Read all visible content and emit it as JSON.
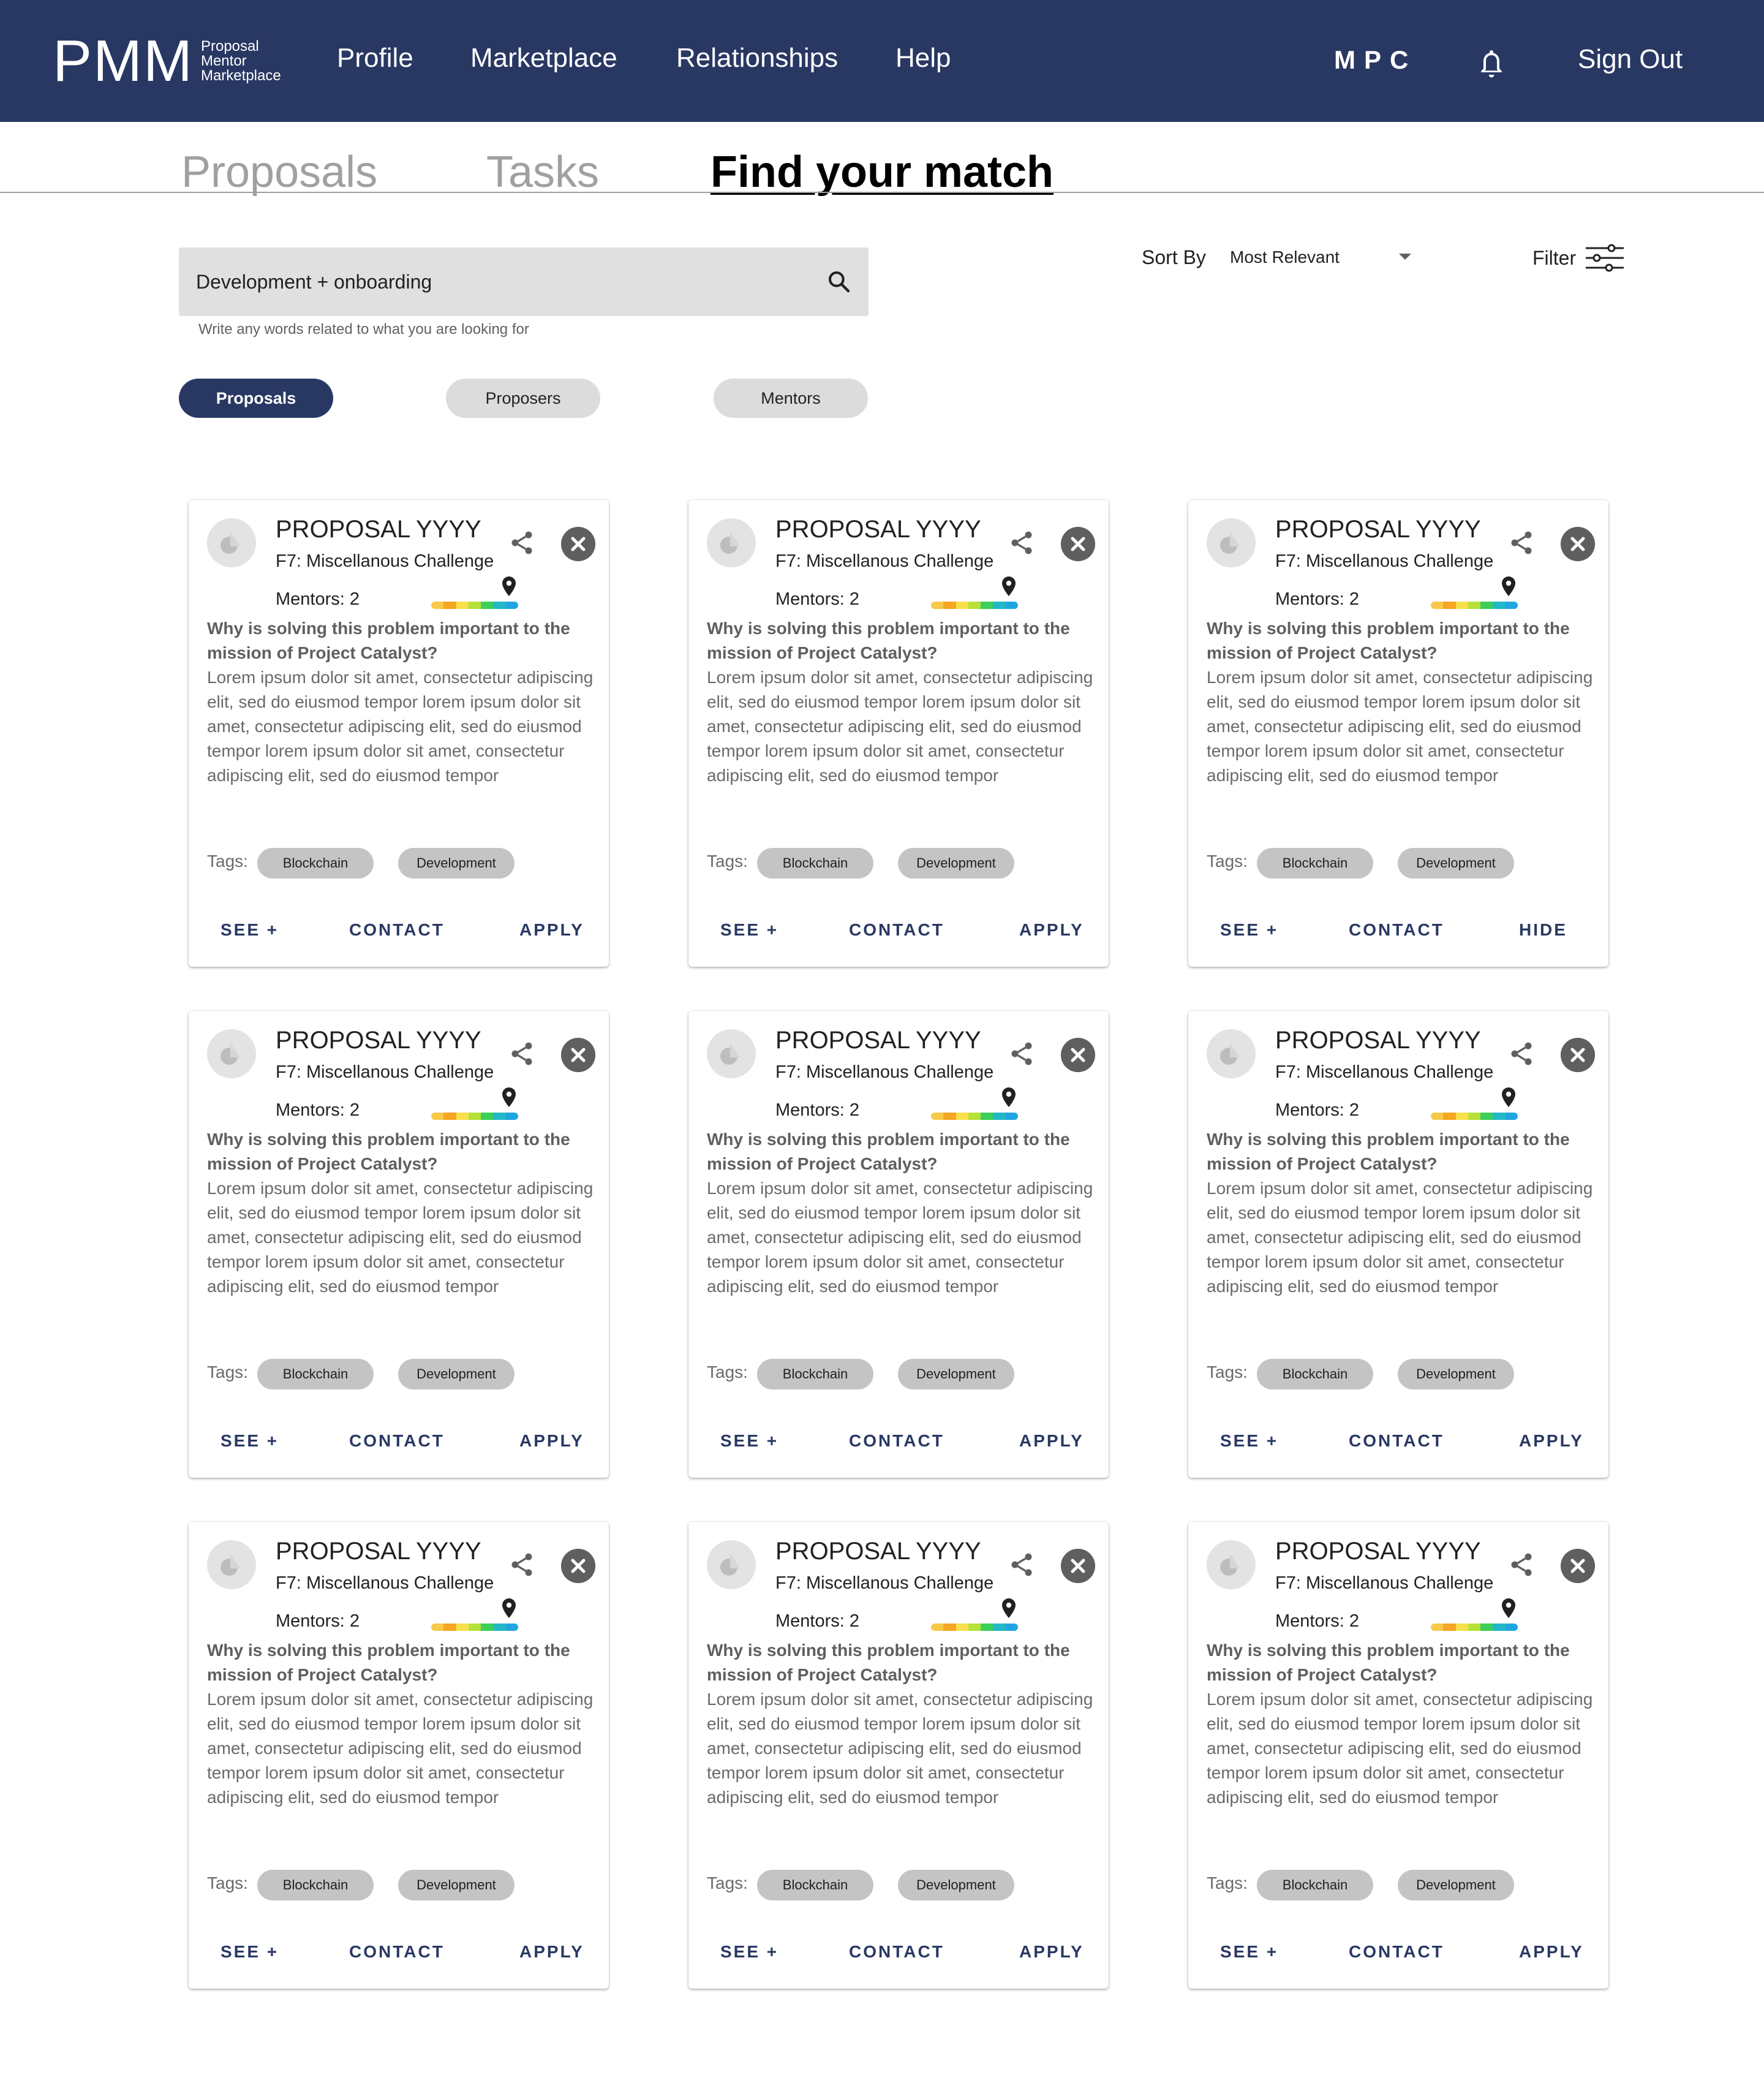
{
  "header": {
    "logo": {
      "mark": "PMM",
      "line1": "Proposal",
      "line2": "Mentor",
      "line3": "Marketplace"
    },
    "nav": [
      "Profile",
      "Marketplace",
      "Relationships",
      "Help"
    ],
    "user_initials": "MPC",
    "sign_out": "Sign Out",
    "colors": {
      "navbar": "#293863",
      "text": "#ffffff"
    }
  },
  "tabs": [
    "Proposals",
    "Tasks",
    "Find your match"
  ],
  "active_tab": "Find your match",
  "search": {
    "value": "Development + onboarding",
    "helper": "Write any words related to what you are looking for"
  },
  "sort": {
    "label": "Sort By",
    "value": "Most Relevant"
  },
  "filter": {
    "label": "Filter"
  },
  "chips": [
    "Proposals",
    "Proposers",
    "Mentors"
  ],
  "active_chip": "Proposals",
  "cards": [
    {
      "title": "PROPOSAL YYYY",
      "challenge": "F7: Miscellanous Challenge",
      "mentors": "Mentors: 2",
      "question": "Why is solving this problem important to the mission of Project Catalyst?",
      "body": "Lorem ipsum dolor sit amet, consectetur adipiscing elit, sed do eiusmod tempor lorem ipsum dolor sit amet, consectetur adipiscing elit, sed do eiusmod tempor lorem ipsum dolor sit amet, consectetur adipiscing elit, sed do eiusmod tempor",
      "tags_label": "Tags:",
      "tags": [
        "Blockchain",
        "Development"
      ],
      "actions": [
        "SEE +",
        "CONTACT",
        "APPLY"
      ]
    },
    {
      "title": "PROPOSAL YYYY",
      "challenge": "F7: Miscellanous Challenge",
      "mentors": "Mentors: 2",
      "question": "Why is solving this problem important to the mission of Project Catalyst?",
      "body": "Lorem ipsum dolor sit amet, consectetur adipiscing elit, sed do eiusmod tempor lorem ipsum dolor sit amet, consectetur adipiscing elit, sed do eiusmod tempor lorem ipsum dolor sit amet, consectetur adipiscing elit, sed do eiusmod tempor",
      "tags_label": "Tags:",
      "tags": [
        "Blockchain",
        "Development"
      ],
      "actions": [
        "SEE +",
        "CONTACT",
        "APPLY"
      ]
    },
    {
      "title": "PROPOSAL YYYY",
      "challenge": "F7: Miscellanous Challenge",
      "mentors": "Mentors: 2",
      "question": "Why is solving this problem important to the mission of Project Catalyst?",
      "body": "Lorem ipsum dolor sit amet, consectetur adipiscing elit, sed do eiusmod tempor lorem ipsum dolor sit amet, consectetur adipiscing elit, sed do eiusmod tempor lorem ipsum dolor sit amet, consectetur adipiscing elit, sed do eiusmod tempor",
      "tags_label": "Tags:",
      "tags": [
        "Blockchain",
        "Development"
      ],
      "actions": [
        "SEE +",
        "CONTACT",
        "HIDE"
      ]
    },
    {
      "title": "PROPOSAL YYYY",
      "challenge": "F7: Miscellanous Challenge",
      "mentors": "Mentors: 2",
      "question": "Why is solving this problem important to the mission of Project Catalyst?",
      "body": "Lorem ipsum dolor sit amet, consectetur adipiscing elit, sed do eiusmod tempor lorem ipsum dolor sit amet, consectetur adipiscing elit, sed do eiusmod tempor lorem ipsum dolor sit amet, consectetur adipiscing elit, sed do eiusmod tempor",
      "tags_label": "Tags:",
      "tags": [
        "Blockchain",
        "Development"
      ],
      "actions": [
        "SEE +",
        "CONTACT",
        "APPLY"
      ]
    },
    {
      "title": "PROPOSAL YYYY",
      "challenge": "F7: Miscellanous Challenge",
      "mentors": "Mentors: 2",
      "question": "Why is solving this problem important to the mission of Project Catalyst?",
      "body": "Lorem ipsum dolor sit amet, consectetur adipiscing elit, sed do eiusmod tempor lorem ipsum dolor sit amet, consectetur adipiscing elit, sed do eiusmod tempor lorem ipsum dolor sit amet, consectetur adipiscing elit, sed do eiusmod tempor",
      "tags_label": "Tags:",
      "tags": [
        "Blockchain",
        "Development"
      ],
      "actions": [
        "SEE +",
        "CONTACT",
        "APPLY"
      ]
    },
    {
      "title": "PROPOSAL YYYY",
      "challenge": "F7: Miscellanous Challenge",
      "mentors": "Mentors: 2",
      "question": "Why is solving this problem important to the mission of Project Catalyst?",
      "body": "Lorem ipsum dolor sit amet, consectetur adipiscing elit, sed do eiusmod tempor lorem ipsum dolor sit amet, consectetur adipiscing elit, sed do eiusmod tempor lorem ipsum dolor sit amet, consectetur adipiscing elit, sed do eiusmod tempor",
      "tags_label": "Tags:",
      "tags": [
        "Blockchain",
        "Development"
      ],
      "actions": [
        "SEE +",
        "CONTACT",
        "APPLY"
      ]
    },
    {
      "title": "PROPOSAL YYYY",
      "challenge": "F7: Miscellanous Challenge",
      "mentors": "Mentors: 2",
      "question": "Why is solving this problem important to the mission of Project Catalyst?",
      "body": "Lorem ipsum dolor sit amet, consectetur adipiscing elit, sed do eiusmod tempor lorem ipsum dolor sit amet, consectetur adipiscing elit, sed do eiusmod tempor lorem ipsum dolor sit amet, consectetur adipiscing elit, sed do eiusmod tempor",
      "tags_label": "Tags:",
      "tags": [
        "Blockchain",
        "Development"
      ],
      "actions": [
        "SEE +",
        "CONTACT",
        "APPLY"
      ]
    },
    {
      "title": "PROPOSAL YYYY",
      "challenge": "F7: Miscellanous Challenge",
      "mentors": "Mentors: 2",
      "question": "Why is solving this problem important to the mission of Project Catalyst?",
      "body": "Lorem ipsum dolor sit amet, consectetur adipiscing elit, sed do eiusmod tempor lorem ipsum dolor sit amet, consectetur adipiscing elit, sed do eiusmod tempor lorem ipsum dolor sit amet, consectetur adipiscing elit, sed do eiusmod tempor",
      "tags_label": "Tags:",
      "tags": [
        "Blockchain",
        "Development"
      ],
      "actions": [
        "SEE +",
        "CONTACT",
        "APPLY"
      ]
    },
    {
      "title": "PROPOSAL YYYY",
      "challenge": "F7: Miscellanous Challenge",
      "mentors": "Mentors: 2",
      "question": "Why is solving this problem important to the mission of Project Catalyst?",
      "body": "Lorem ipsum dolor sit amet, consectetur adipiscing elit, sed do eiusmod tempor lorem ipsum dolor sit amet, consectetur adipiscing elit, sed do eiusmod tempor lorem ipsum dolor sit amet, consectetur adipiscing elit, sed do eiusmod tempor",
      "tags_label": "Tags:",
      "tags": [
        "Blockchain",
        "Development"
      ],
      "actions": [
        "SEE +",
        "CONTACT",
        "APPLY"
      ]
    }
  ],
  "match_bar_colors": [
    "#f7c948",
    "#f5a623",
    "#f7e04b",
    "#b8e03a",
    "#3ccf5a",
    "#22b8c8",
    "#1fa6e0"
  ],
  "icons": [
    "bell-icon",
    "search-icon",
    "filter-icon",
    "share-icon",
    "close-icon",
    "map-pin-icon",
    "avatar-icon"
  ]
}
